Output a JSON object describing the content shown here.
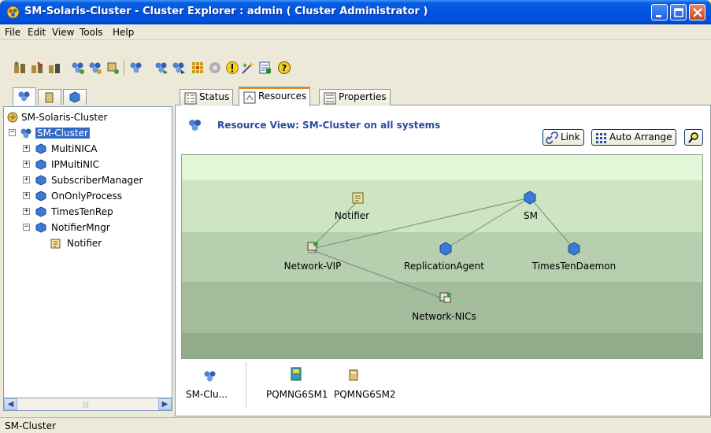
{
  "window": {
    "title": "SM-Solaris-Cluster - Cluster Explorer : admin ( Cluster Administrator )"
  },
  "menu": [
    "File",
    "Edit",
    "View",
    "Tools",
    "Help"
  ],
  "tree": {
    "root": "SM-Solaris-Cluster",
    "cluster": "SM-Cluster",
    "groups": [
      "MultiNICA",
      "IPMultiNIC",
      "SubscriberManager",
      "OnOnlyProcess",
      "TimesTenRep",
      "NotifierMngr"
    ],
    "child": "Notifier"
  },
  "tabs": [
    "Status",
    "Resources",
    "Properties"
  ],
  "active_tab": "Resources",
  "resource_view": {
    "title": "Resource View: SM-Cluster on all systems",
    "link_button": "Link",
    "auto_arrange_button": "Auto Arrange"
  },
  "graph": {
    "nodes": [
      "Notifier",
      "SM",
      "Network-VIP",
      "ReplicationAgent",
      "TimesTenDaemon",
      "Network-NICs"
    ],
    "edges": [
      [
        "SM",
        "Network-VIP"
      ],
      [
        "SM",
        "ReplicationAgent"
      ],
      [
        "SM",
        "TimesTenDaemon"
      ],
      [
        "Notifier",
        "Network-VIP"
      ],
      [
        "Network-VIP",
        "Network-NICs"
      ]
    ]
  },
  "systems": {
    "cluster_label": "SM-Clu...",
    "system1": "PQMNG6SM1",
    "system2": "PQMNG6SM2"
  },
  "status": {
    "text": "SM-Cluster"
  }
}
